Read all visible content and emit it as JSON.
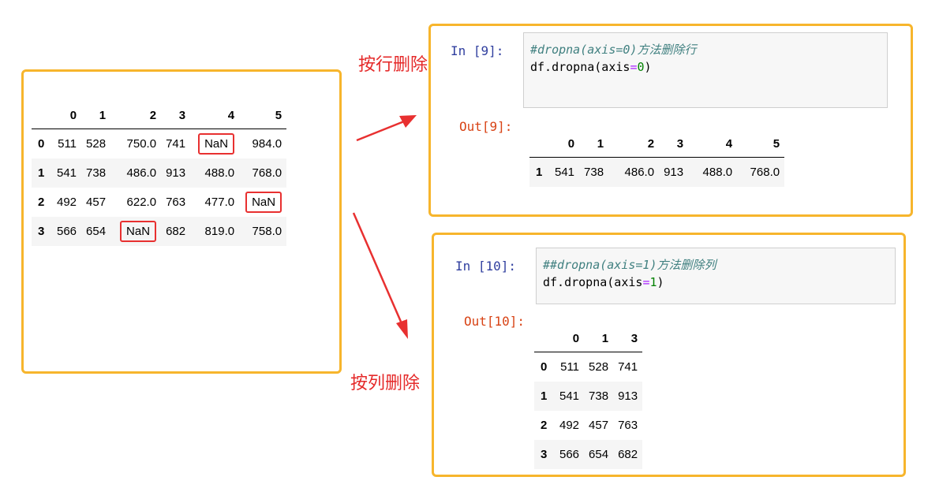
{
  "colors": {
    "panel_border": "#f7b52c",
    "arrow": "#e83030",
    "label": "#e52a2a",
    "in_prompt": "#303f9f",
    "out_prompt": "#d84315"
  },
  "labels": {
    "row_delete": "按行删除",
    "col_delete": "按列删除"
  },
  "original_df": {
    "columns": [
      "0",
      "1",
      "2",
      "3",
      "4",
      "5"
    ],
    "rows": [
      {
        "index": "0",
        "cells": [
          "511",
          "528",
          "750.0",
          "741",
          "NaN",
          "984.0"
        ]
      },
      {
        "index": "1",
        "cells": [
          "541",
          "738",
          "486.0",
          "913",
          "488.0",
          "768.0"
        ]
      },
      {
        "index": "2",
        "cells": [
          "492",
          "457",
          "622.0",
          "763",
          "477.0",
          "NaN"
        ]
      },
      {
        "index": "3",
        "cells": [
          "566",
          "654",
          "NaN",
          "682",
          "819.0",
          "758.0"
        ]
      }
    ]
  },
  "cell9": {
    "in_prompt": "In  [9]:",
    "comment": "#dropna(axis=0)方法删除行",
    "code_prefix": "df.dropna(axis",
    "code_eq": "=",
    "code_num": "0",
    "code_suffix": ")",
    "out_prompt": "Out[9]:",
    "columns": [
      "0",
      "1",
      "2",
      "3",
      "4",
      "5"
    ],
    "rows": [
      {
        "index": "1",
        "cells": [
          "541",
          "738",
          "486.0",
          "913",
          "488.0",
          "768.0"
        ]
      }
    ]
  },
  "cell10": {
    "in_prompt": "In  [10]:",
    "comment": "##dropna(axis=1)方法删除列",
    "code_prefix": "df.dropna(axis",
    "code_eq": "=",
    "code_num": "1",
    "code_suffix": ")",
    "out_prompt": "Out[10]:",
    "columns": [
      "0",
      "1",
      "3"
    ],
    "rows": [
      {
        "index": "0",
        "cells": [
          "511",
          "528",
          "741"
        ]
      },
      {
        "index": "1",
        "cells": [
          "541",
          "738",
          "913"
        ]
      },
      {
        "index": "2",
        "cells": [
          "492",
          "457",
          "763"
        ]
      },
      {
        "index": "3",
        "cells": [
          "566",
          "654",
          "682"
        ]
      }
    ]
  }
}
